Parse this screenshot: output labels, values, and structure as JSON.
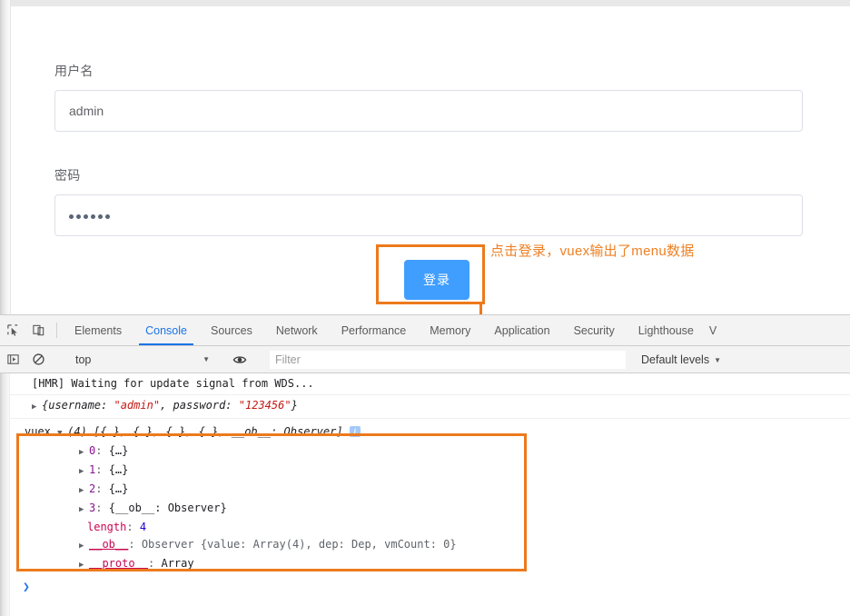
{
  "login_form": {
    "username_label": "用户名",
    "username_value": "admin",
    "password_label": "密码",
    "password_dots": 6,
    "password_masked": "••••••",
    "submit_label": "登录"
  },
  "annotation": {
    "text": "点击登录，vuex输出了menu数据",
    "color": "#ec7a1c"
  },
  "devtools": {
    "inspect_icon": "inspect-element-icon",
    "device_icon": "device-toolbar-icon",
    "tabs": [
      {
        "label": "Elements",
        "active": false
      },
      {
        "label": "Console",
        "active": true
      },
      {
        "label": "Sources",
        "active": false
      },
      {
        "label": "Network",
        "active": false
      },
      {
        "label": "Performance",
        "active": false
      },
      {
        "label": "Memory",
        "active": false
      },
      {
        "label": "Application",
        "active": false
      },
      {
        "label": "Security",
        "active": false
      },
      {
        "label": "Lighthouse",
        "active": false
      },
      {
        "label": "V",
        "active": false
      }
    ],
    "filterbar": {
      "execute_icon": "execute-sidebar-icon",
      "clear_icon": "clear-console-icon",
      "context": "top",
      "context_caret": "▼",
      "eye_icon": "live-expression-eye-icon",
      "filter_placeholder": "Filter",
      "levels_label": "Default levels",
      "levels_caret": "▼"
    },
    "console": {
      "rows": [
        {
          "text": "[HMR] Waiting for update signal from WDS..."
        },
        {
          "text": "{username: \"admin\", password: \"123456\"}"
        }
      ],
      "hmr_message": "[HMR] Waiting for update signal from WDS...",
      "login_obj": {
        "prefix": "{username: ",
        "username": "\"admin\"",
        "mid": ", password: ",
        "password": "\"123456\"",
        "suffix": "}"
      },
      "vuex": {
        "label": "vuex",
        "caret": "▼",
        "summary": "(4) [{…}, {…}, {…}, {…}, __ob__: Observer]",
        "info_badge": "i",
        "children": [
          {
            "key": "0",
            "value": "{…}",
            "expandable": true
          },
          {
            "key": "1",
            "value": "{…}",
            "expandable": true
          },
          {
            "key": "2",
            "value": "{…}",
            "expandable": true
          },
          {
            "key": "3",
            "value": "{__ob__: Observer}",
            "expandable": true
          },
          {
            "key": "length",
            "value": "4",
            "expandable": false
          },
          {
            "key": "__ob__",
            "value": "Observer {value: Array(4), dep: Dep, vmCount: 0}",
            "expandable": true
          },
          {
            "key": "__proto__",
            "value": "Array",
            "expandable": true
          }
        ]
      },
      "prompt_caret": "❯"
    }
  }
}
